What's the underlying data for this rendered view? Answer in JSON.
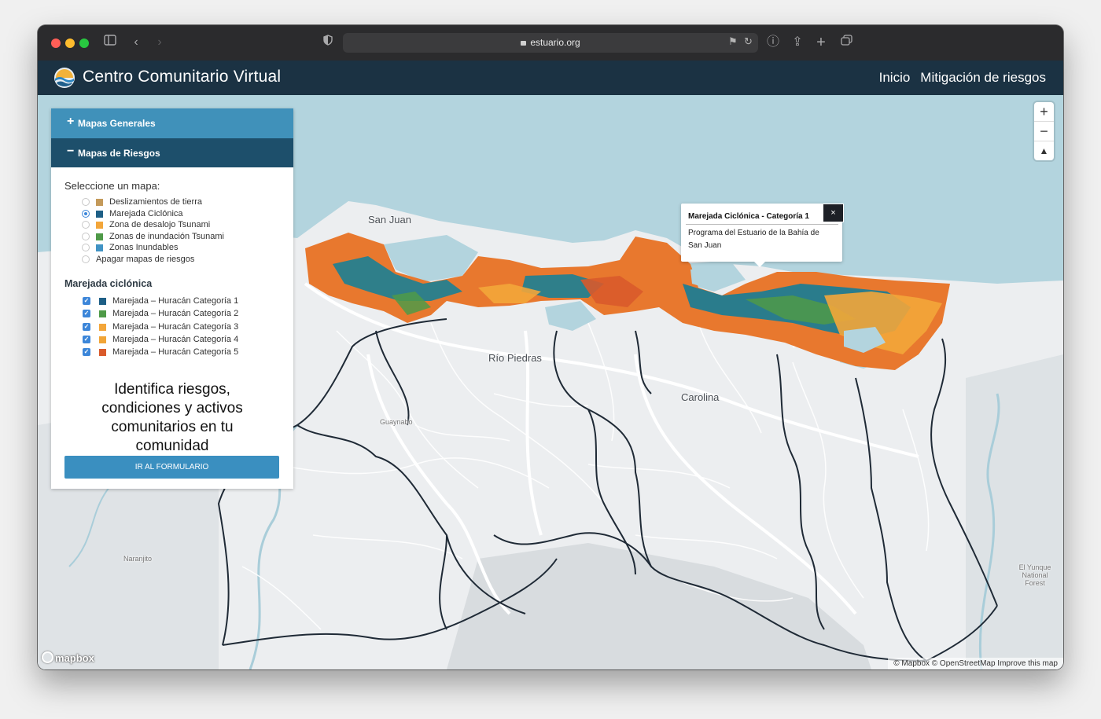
{
  "browser": {
    "url": "estuario.org"
  },
  "site": {
    "title": "Centro Comunitario Virtual",
    "nav": [
      "Inicio",
      "Mitigación de riesgos"
    ]
  },
  "panel": {
    "accordion_general": "Mapas Generales",
    "accordion_general_sign": "+",
    "accordion_riesgos": "Mapas de Riesgos",
    "accordion_riesgos_sign": "−",
    "select_label": "Seleccione un mapa:",
    "map_options": [
      {
        "label": "Deslizamientos de tierra",
        "color": "#c49a5a",
        "selected": false
      },
      {
        "label": "Marejada Ciclónica",
        "color": "#1e5f86",
        "selected": true
      },
      {
        "label": "Zona de desalojo Tsunami",
        "color": "#f3a63a",
        "selected": false
      },
      {
        "label": "Zonas de inundación Tsunami",
        "color": "#4f9a48",
        "selected": false
      },
      {
        "label": "Zonas Inundables",
        "color": "#4193c4",
        "selected": false
      },
      {
        "label": "Apagar mapas de riesgos",
        "color": null,
        "selected": false
      }
    ],
    "legend_title": "Marejada ciclónica",
    "legend_items": [
      {
        "label": "Marejada – Huracán Categoría 1",
        "color": "#1e5f86",
        "checked": true
      },
      {
        "label": "Marejada – Huracán Categoría 2",
        "color": "#4f9a48",
        "checked": true
      },
      {
        "label": "Marejada – Huracán Categoría 3",
        "color": "#f3a63a",
        "checked": true
      },
      {
        "label": "Marejada – Huracán Categoría 4",
        "color": "#f1a537",
        "checked": true
      },
      {
        "label": "Marejada – Huracán Categoría 5",
        "color": "#d95a2b",
        "checked": true
      }
    ],
    "cta_text": "Identifica riesgos, condiciones y activos comunitarios en tu comunidad",
    "cta_button": "IR AL FORMULARIO"
  },
  "map": {
    "places": {
      "san_juan": "San Juan",
      "rio_piedras": "Río Piedras",
      "carolina": "Carolina",
      "guaynabo": "Guaynabo",
      "naranjito": "Naranjito",
      "el_yunque": "El Yunque National Forest"
    },
    "zoom_in": "+",
    "zoom_out": "−",
    "compass": "▲",
    "logo": "mapbox",
    "attribution": "© Mapbox © OpenStreetMap Improve this map",
    "popup": {
      "title": "Marejada Ciclónica - Categoría 1",
      "body": "Programa del Estuario de la Bahía de San Juan",
      "close": "×"
    }
  }
}
